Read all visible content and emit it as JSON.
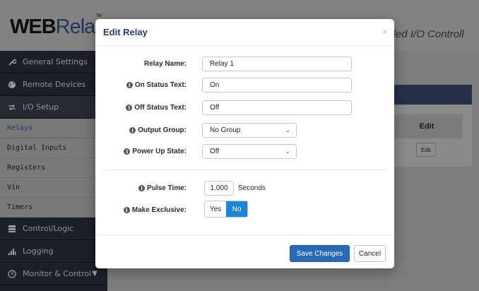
{
  "brand": {
    "logo_web": "WEB",
    "logo_relay": "Relay",
    "trademark": "TM",
    "tagline": "abled I/O Controll"
  },
  "sidebar": {
    "items": [
      {
        "label": "General Settings",
        "icon": "wrench-icon"
      },
      {
        "label": "Remote Devices",
        "icon": "globe-icon"
      },
      {
        "label": "I/O Setup",
        "icon": "io-setup-icon"
      }
    ],
    "sub_items": [
      "Relays",
      "Digital Inputs",
      "Registers",
      "Vin",
      "Timers"
    ],
    "bottom_items": [
      {
        "label": "Control/Logic",
        "icon": "server-icon"
      },
      {
        "label": "Logging",
        "icon": "bar-chart-icon"
      },
      {
        "label": "Monitor & Control",
        "icon": "clock-icon"
      }
    ]
  },
  "background_table": {
    "edit_header": "Edit",
    "edit_button": "Edit"
  },
  "modal": {
    "title": "Edit Relay",
    "close": "×",
    "fields": {
      "relay_name": {
        "label": "Relay Name:",
        "value": "Relay 1"
      },
      "on_status": {
        "label": "On Status Text:",
        "value": "On"
      },
      "off_status": {
        "label": "Off Status Text:",
        "value": "Off"
      },
      "output_group": {
        "label": "Output Group:",
        "value": "No Group"
      },
      "power_up": {
        "label": "Power Up State:",
        "value": "Off"
      },
      "pulse_time": {
        "label": "Pulse Time:",
        "value": "1.000",
        "unit": "Seconds"
      },
      "exclusive": {
        "label": "Make Exclusive:",
        "yes": "Yes",
        "no": "No",
        "selected": "No"
      }
    },
    "save_label": "Save Changes",
    "cancel_label": "Cancel"
  },
  "colors": {
    "accent": "#1b86d6",
    "primary_button": "#2a6ab5",
    "title": "#243b73"
  }
}
